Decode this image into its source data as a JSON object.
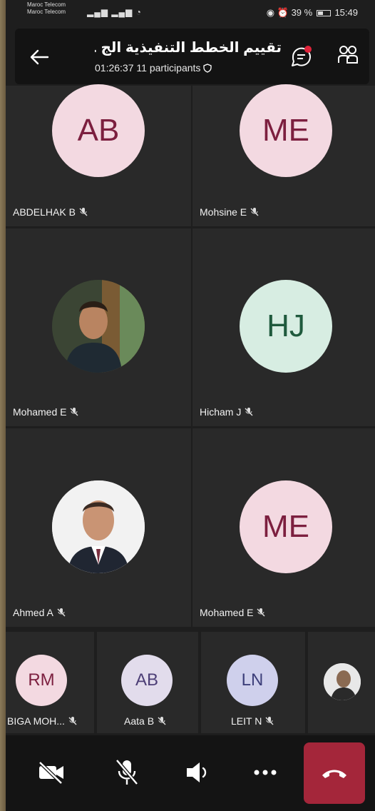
{
  "status_bar": {
    "carrier_1": "Maroc Telecom",
    "carrier_2": "Maroc Telecom",
    "battery": "39 %",
    "time": "15:49"
  },
  "header": {
    "title": "تقييم الخطط التنفيذية الج ...",
    "duration": "01:26:37",
    "participants": "11 participants",
    "icons": [
      "back-arrow-icon",
      "chat-icon",
      "people-icon",
      "shield-icon"
    ],
    "chat_unread_color": "#e0233a"
  },
  "tiles": [
    {
      "initials": "AB",
      "name": "ABDELHAK B",
      "muted": true,
      "avatar_color": "pink"
    },
    {
      "initials": "ME",
      "name": "Mohsine E",
      "muted": true,
      "avatar_color": "pink"
    },
    {
      "initials": "",
      "name": "Mohamed E",
      "muted": true,
      "avatar_color": "photo"
    },
    {
      "initials": "HJ",
      "name": "Hicham J",
      "muted": true,
      "avatar_color": "green"
    },
    {
      "initials": "",
      "name": "Ahmed A",
      "muted": true,
      "avatar_color": "photo"
    },
    {
      "initials": "ME",
      "name": "Mohamed E",
      "muted": true,
      "avatar_color": "pink"
    }
  ],
  "small_tiles": [
    {
      "initials": "RM",
      "name": "BIGA MOH...",
      "muted": true
    },
    {
      "initials": "AB",
      "name": "Aata B",
      "muted": true
    },
    {
      "initials": "LN",
      "name": "LEIT N",
      "muted": true
    },
    {
      "initials": "",
      "name": "",
      "muted": false
    }
  ],
  "controls": {
    "icons": [
      "camera-off-icon",
      "mic-off-icon",
      "speaker-icon",
      "more-icon",
      "hang-up-icon"
    ],
    "hangup_color": "#a4263a"
  }
}
